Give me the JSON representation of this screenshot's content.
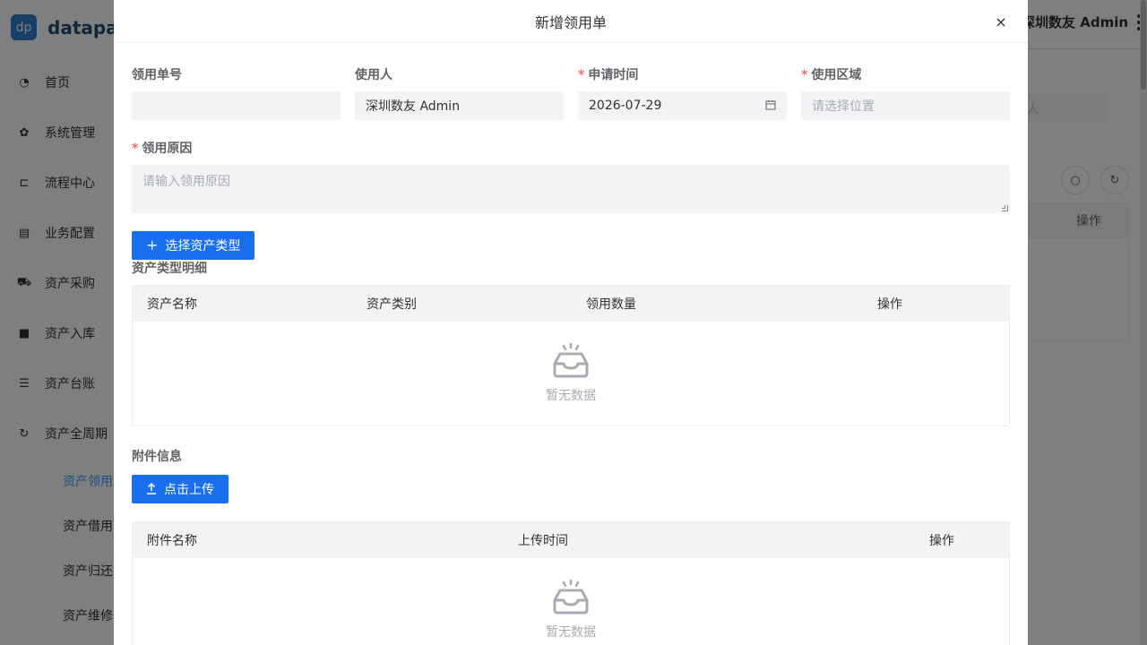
{
  "background": {
    "logo": {
      "badge": "dp",
      "text": "datapart"
    },
    "menu": [
      {
        "label": "首页",
        "icon": "dashboard-icon"
      },
      {
        "label": "系统管理",
        "icon": "gear-icon"
      },
      {
        "label": "流程中心",
        "icon": "flow-icon"
      },
      {
        "label": "业务配置",
        "icon": "document-icon"
      },
      {
        "label": "资产采购",
        "icon": "cart-icon"
      },
      {
        "label": "资产入库",
        "icon": "film-icon"
      },
      {
        "label": "资产台账",
        "icon": "list-icon"
      },
      {
        "label": "资产全周期",
        "icon": "cycle-icon"
      }
    ],
    "submenu": [
      "资产领用",
      "资产借用",
      "资产归还",
      "资产维修"
    ],
    "user": "深圳数友 Admin",
    "table_action_header": "操作",
    "search_placeholder": "人"
  },
  "dialog": {
    "title": "新增领用单",
    "close_glyph": "×",
    "fields": {
      "order_no": {
        "label": "领用单号",
        "value": ""
      },
      "user": {
        "label": "使用人",
        "value": "深圳数友 Admin"
      },
      "apply_time": {
        "label": "申请时间",
        "value": "2026-07-29",
        "required": "*"
      },
      "area": {
        "label": "使用区域",
        "placeholder": "请选择位置",
        "required": "*"
      },
      "reason": {
        "label": "领用原因",
        "placeholder": "请输入领用原因",
        "required": "*"
      }
    },
    "select_asset_button": {
      "icon": "+",
      "label": "选择资产类型"
    },
    "asset_detail": {
      "title": "资产类型明细",
      "columns": [
        "资产名称",
        "资产类别",
        "领用数量",
        "操作"
      ],
      "empty_text": "暂无数据"
    },
    "attachment": {
      "title": "附件信息",
      "upload_button": "点击上传",
      "columns": [
        "附件名称",
        "上传时间",
        "操作"
      ],
      "empty_text": "暂无数据"
    }
  }
}
